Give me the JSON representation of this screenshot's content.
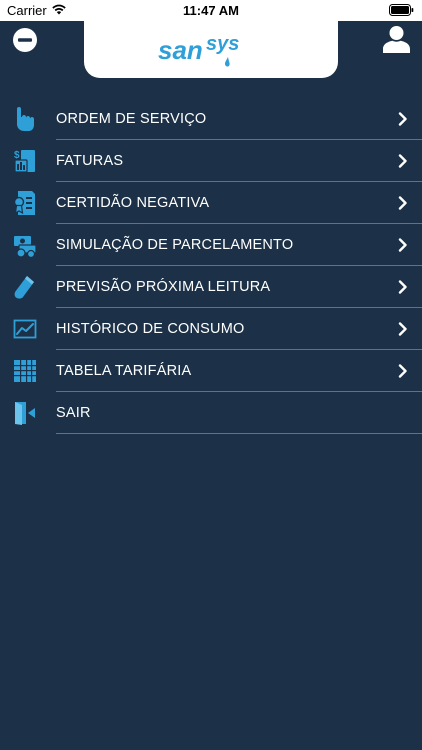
{
  "status_bar": {
    "carrier": "Carrier",
    "time": "11:47 AM"
  },
  "header": {
    "logo_text": "sansys",
    "menu_icon": "minus-circle-icon",
    "profile_icon": "user-icon"
  },
  "menu": {
    "items": [
      {
        "label": "ORDEM DE SERVIÇO",
        "icon": "hand-pointer-icon",
        "has_chevron": true
      },
      {
        "label": "FATURAS",
        "icon": "invoice-icon",
        "has_chevron": true
      },
      {
        "label": "CERTIDÃO NEGATIVA",
        "icon": "certificate-icon",
        "has_chevron": true
      },
      {
        "label": "SIMULAÇÃO DE PARCELAMENTO",
        "icon": "money-simulation-icon",
        "has_chevron": true
      },
      {
        "label": "PREVISÃO PRÓXIMA LEITURA",
        "icon": "pencil-reading-icon",
        "has_chevron": true
      },
      {
        "label": "HISTÓRICO DE CONSUMO",
        "icon": "line-chart-icon",
        "has_chevron": true
      },
      {
        "label": "TABELA TARIFÁRIA",
        "icon": "table-grid-icon",
        "has_chevron": true
      },
      {
        "label": "SAIR",
        "icon": "exit-door-icon",
        "has_chevron": false
      }
    ]
  },
  "colors": {
    "background": "#1c3147",
    "accent": "#2f9fd7",
    "divider": "#5f7386",
    "text": "#ffffff"
  }
}
